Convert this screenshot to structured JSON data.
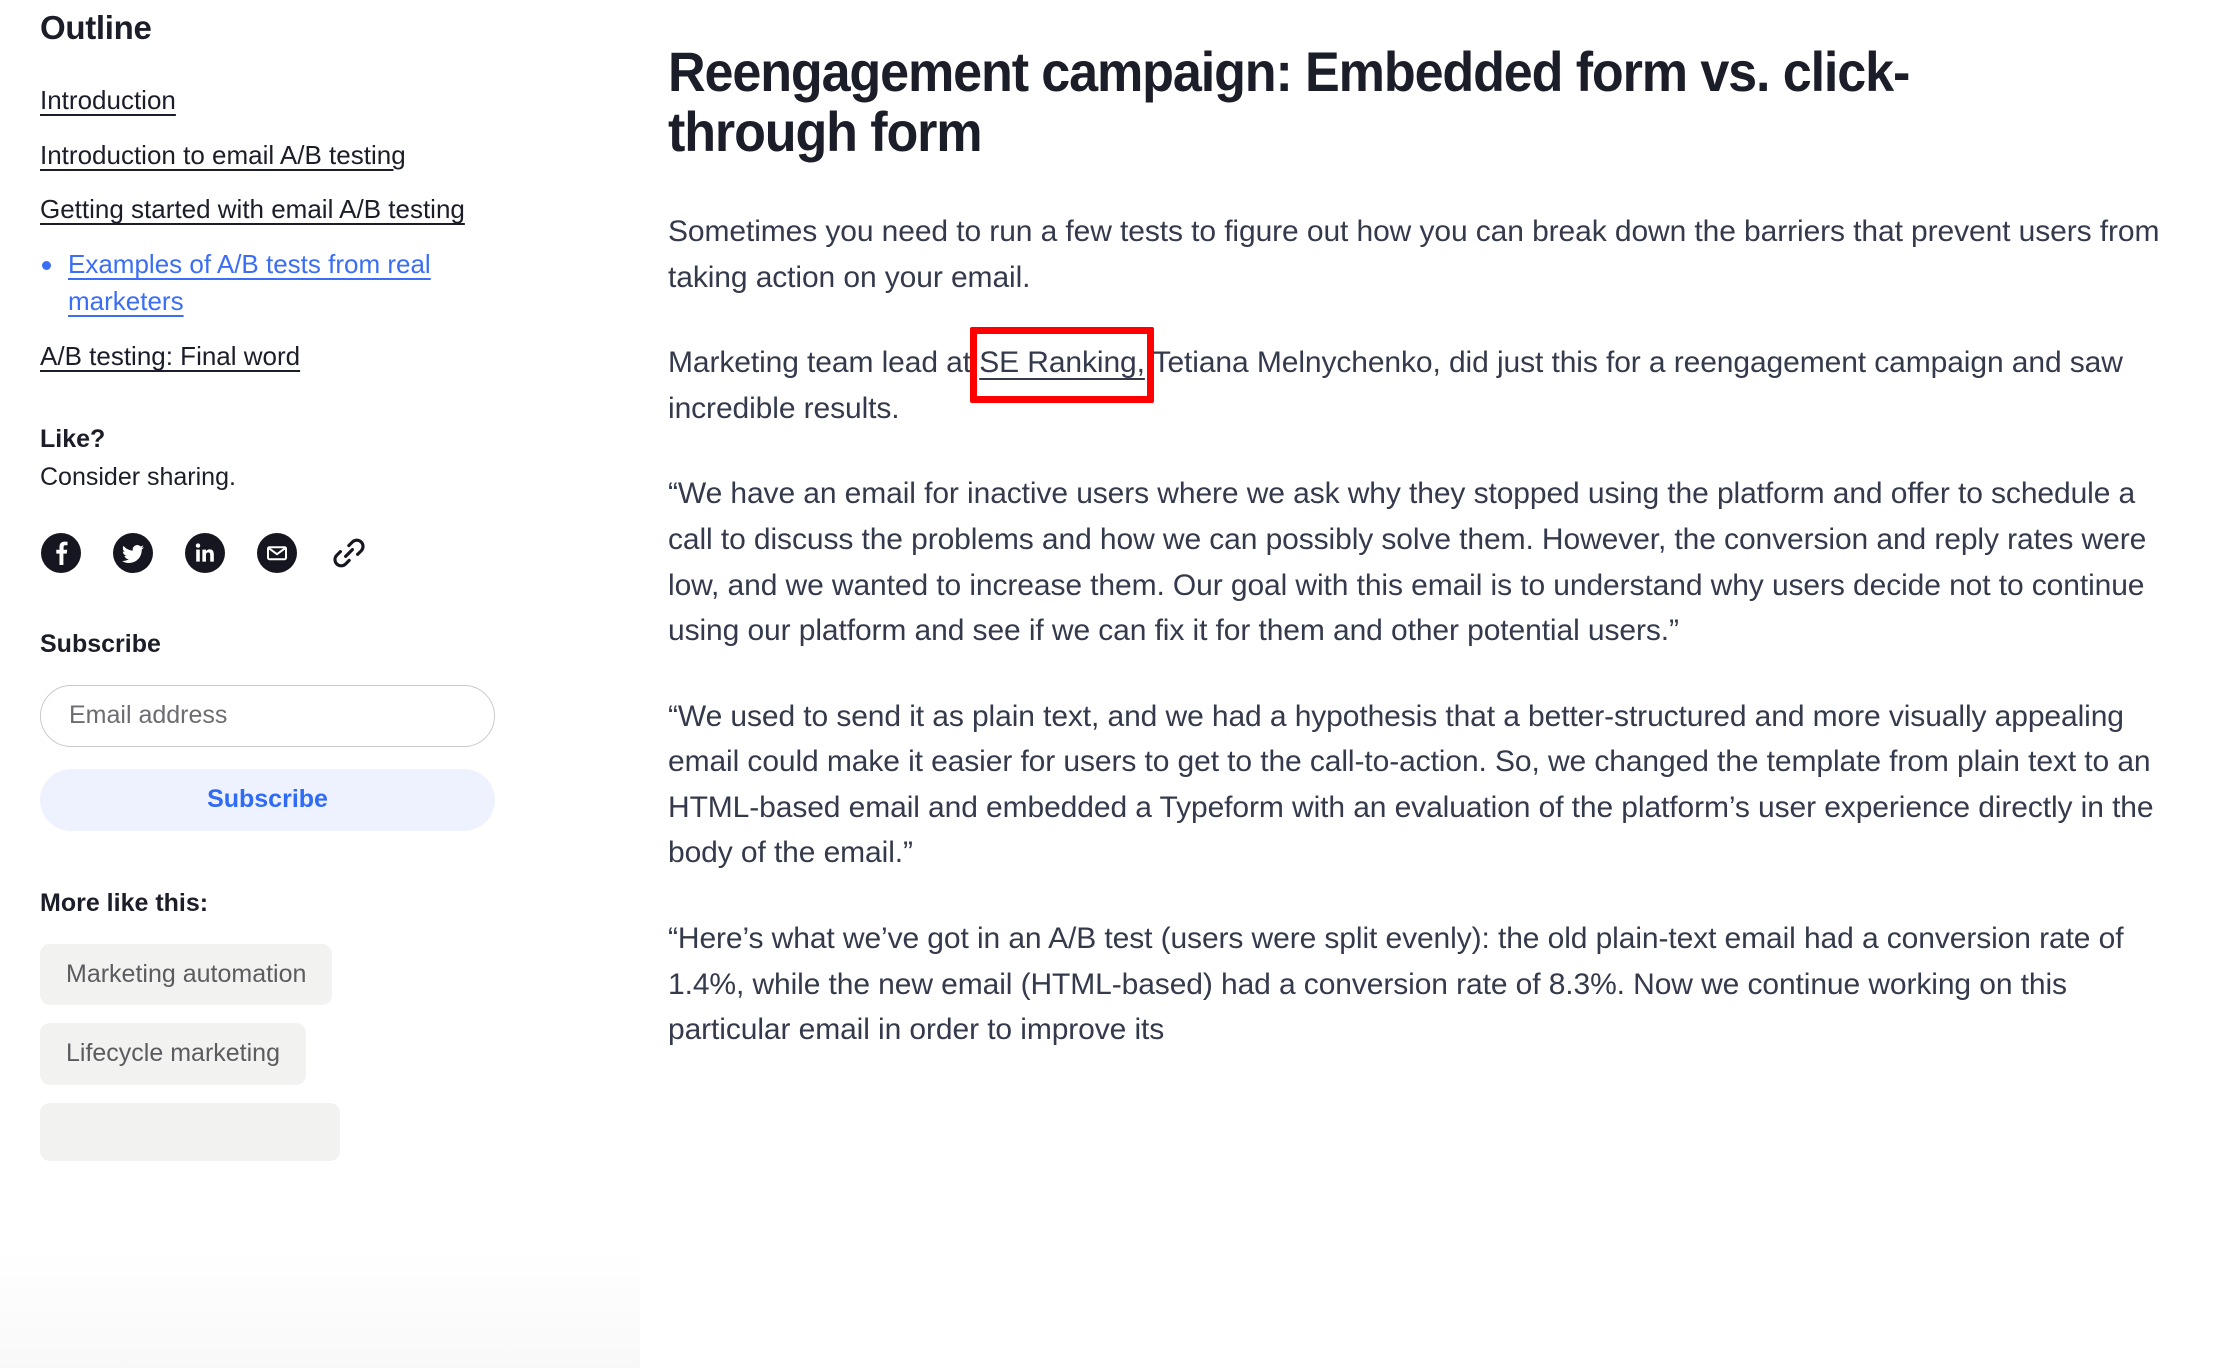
{
  "sidebar": {
    "outline": {
      "title": "Outline",
      "items": [
        {
          "label": "Introduction",
          "active": false,
          "bullet": false
        },
        {
          "label": "Introduction to email A/B testing",
          "active": false,
          "bullet": false
        },
        {
          "label": "Getting started with email A/B testing",
          "active": false,
          "bullet": false
        },
        {
          "label": "Examples of A/B tests from real marketers",
          "active": true,
          "bullet": true
        },
        {
          "label": "A/B testing: Final word",
          "active": false,
          "bullet": false
        }
      ]
    },
    "share": {
      "title": "Like?",
      "subtitle": "Consider sharing.",
      "icons": [
        {
          "name": "facebook-icon",
          "label": "Share on Facebook"
        },
        {
          "name": "twitter-icon",
          "label": "Share on Twitter"
        },
        {
          "name": "linkedin-icon",
          "label": "Share on LinkedIn"
        },
        {
          "name": "email-icon",
          "label": "Share by email"
        },
        {
          "name": "link-icon",
          "label": "Copy link"
        }
      ]
    },
    "subscribe": {
      "title": "Subscribe",
      "email_placeholder": "Email address",
      "email_value": "",
      "button_label": "Subscribe"
    },
    "more_like_this": {
      "title": "More like this:",
      "tags": [
        {
          "label": "Marketing automation"
        },
        {
          "label": "Lifecycle marketing"
        },
        {
          "label": ""
        }
      ]
    }
  },
  "article": {
    "title": "Reengagement campaign: Embedded form vs. click-through form",
    "paragraphs": [
      {
        "id": "p1",
        "text": "Sometimes you need to run a few tests to figure out how you can break down the barriers that prevent users from taking action on your email."
      },
      {
        "id": "p2",
        "before": "Marketing team lead at ",
        "link": "SE Ranking,",
        "after": " Tetiana Melnychenko, did just this for a reengagement campaign and saw incredible results."
      },
      {
        "id": "p3",
        "text": "“We have an email for inactive users where we ask why they stopped using the platform and offer to schedule a call to discuss the problems and how we can possibly solve them. However, the conversion and reply rates were low, and we wanted to increase them. Our goal with this email is to understand why users decide not to continue using our platform and see if we can fix it for them and other potential users.”"
      },
      {
        "id": "p4",
        "text": "“We used to send it as plain text, and we had a hypothesis that a better-structured and more visually appealing email could make it easier for users to get to the call-to-action. So, we changed the template from plain text to an HTML-based email and embedded a Typeform with an evaluation of the platform’s user experience directly in the body of the email.”"
      },
      {
        "id": "p5",
        "text": "“Here’s what we’ve got in an A/B test (users were split evenly): the old plain-text email had a conversion rate of 1.4%, while the new email (HTML-based) had a conversion rate of 8.3%. Now we continue working on this particular email in order to improve its"
      }
    ]
  },
  "annotation": {
    "highlight_target": "SE Ranking,",
    "box_color": "#ff0000"
  },
  "colors": {
    "text_primary": "#1b1d29",
    "text_body": "#343a4c",
    "link_blue": "#3b6ef5",
    "subscribe_bg": "#eef2fe",
    "tag_bg": "#f2f2f0",
    "tag_text": "#5c5c60",
    "highlight_red": "#ff0000"
  }
}
